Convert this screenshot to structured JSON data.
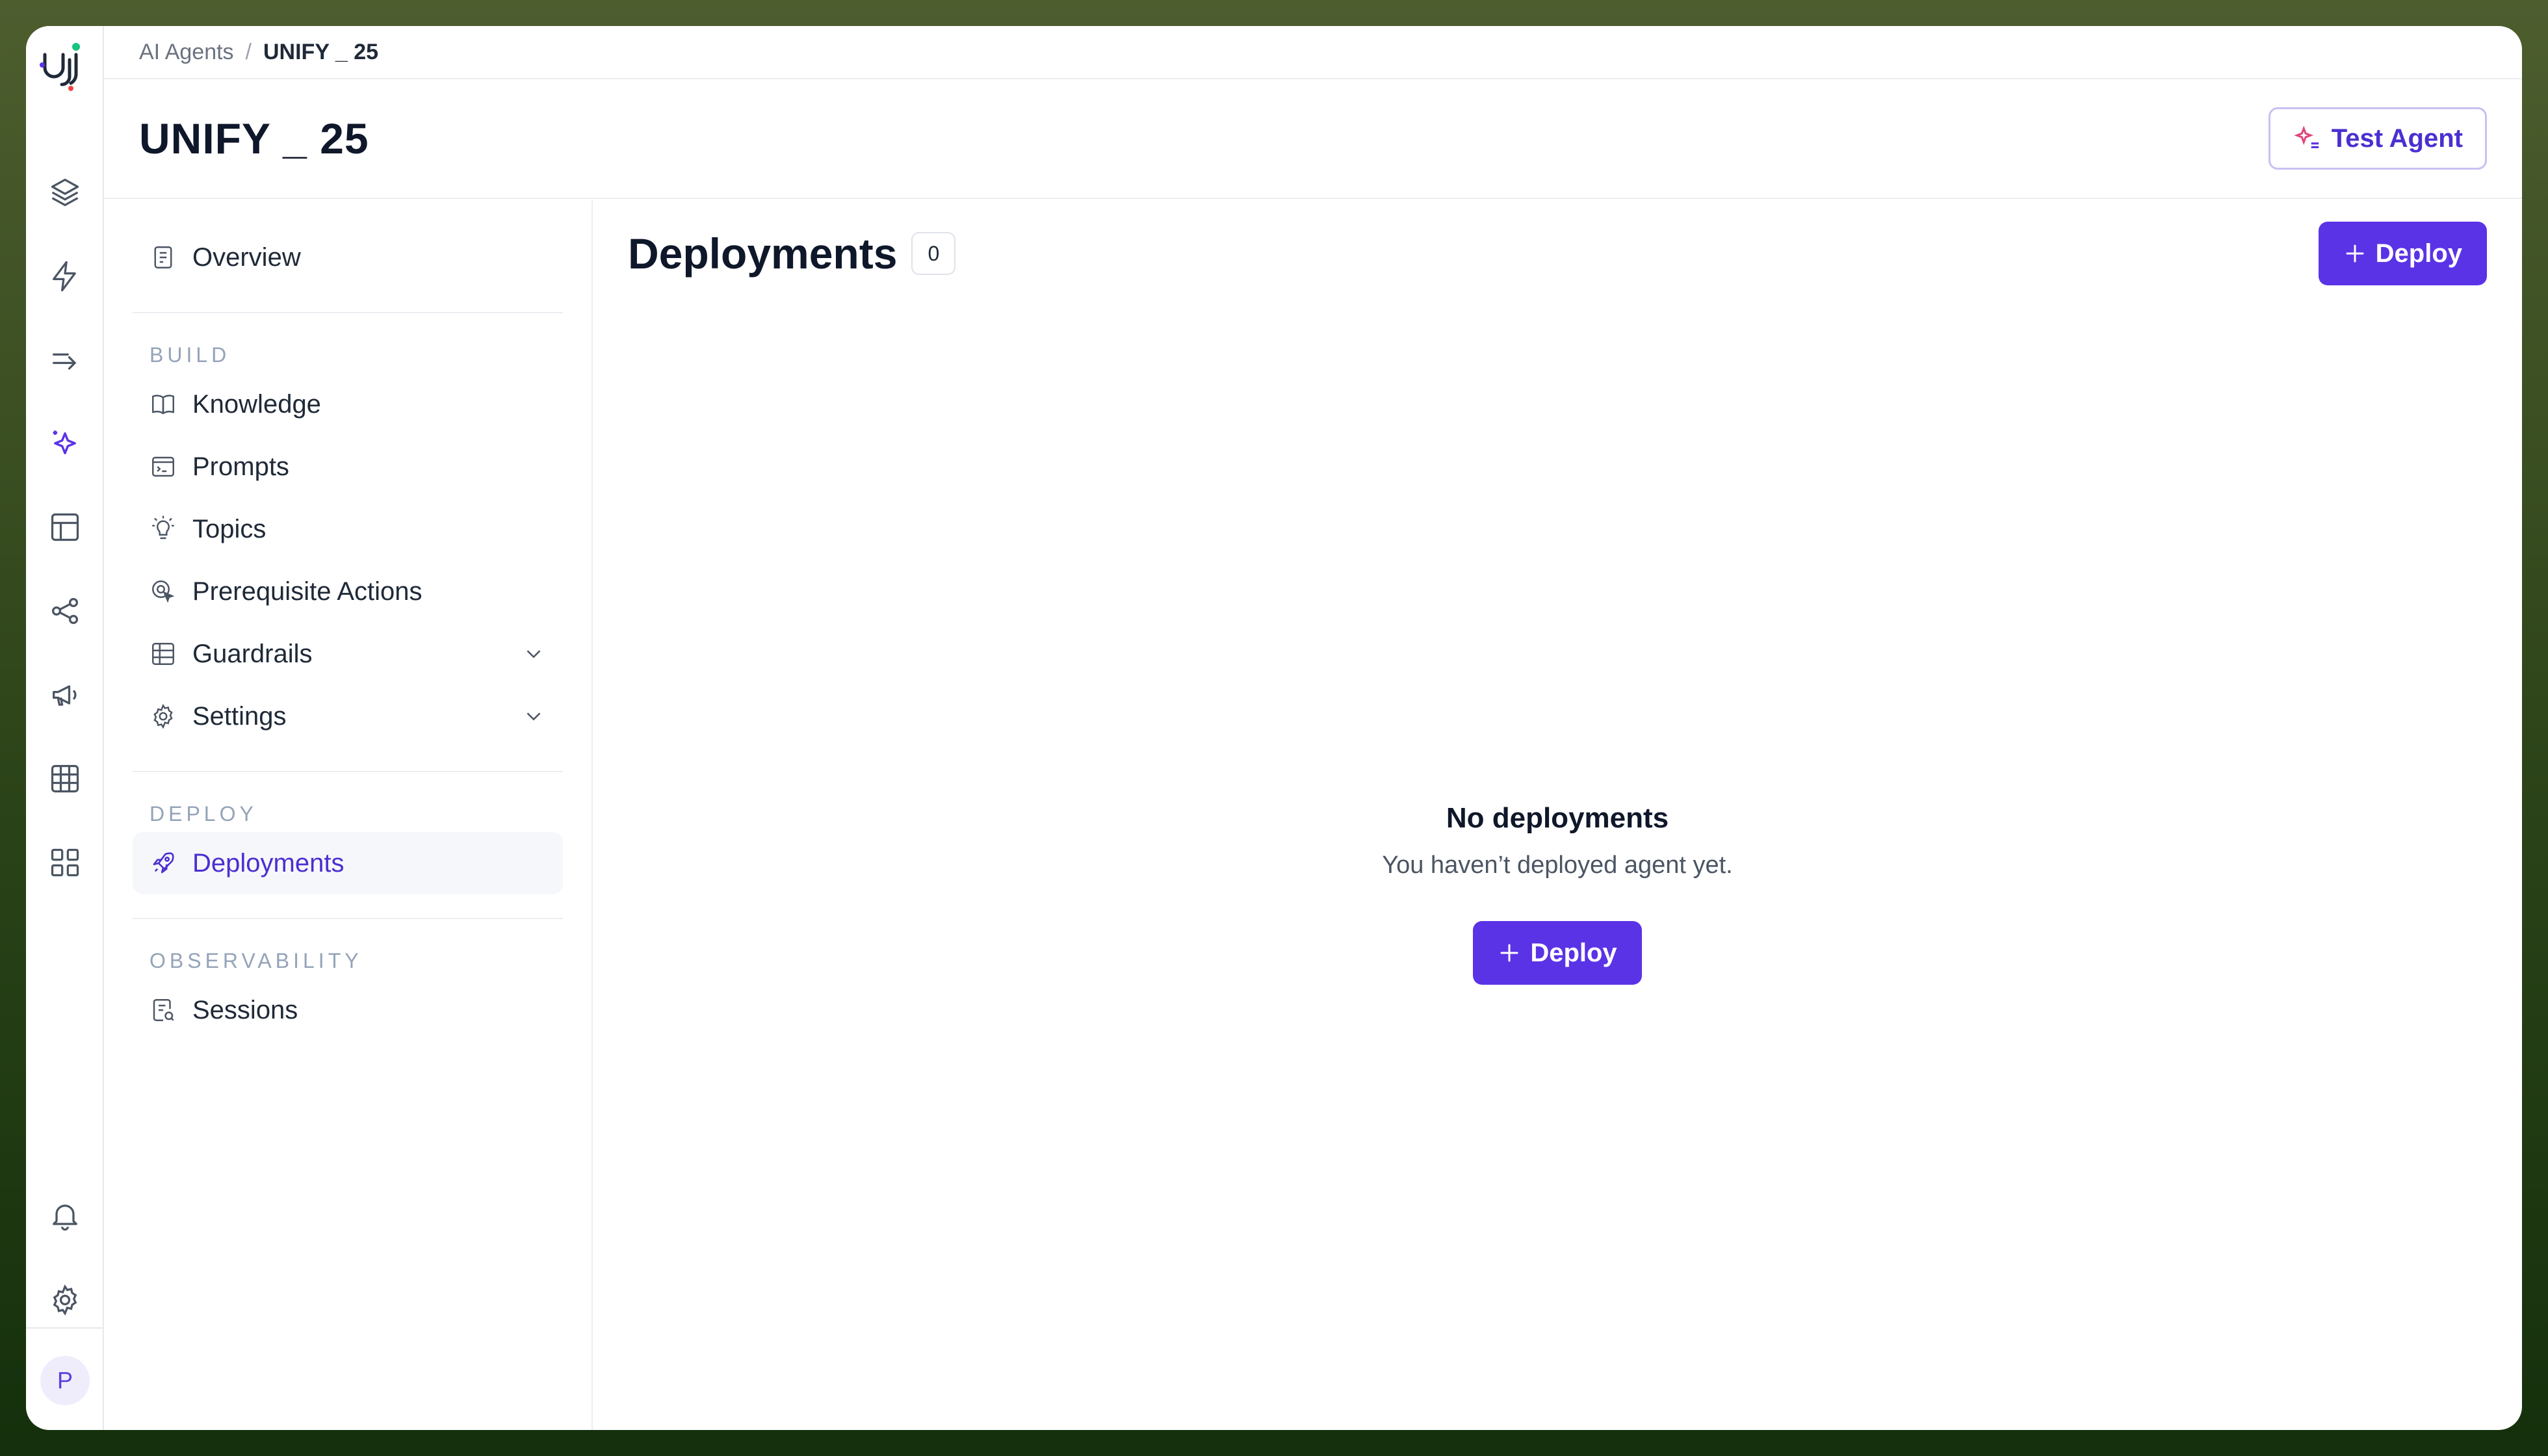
{
  "breadcrumb": {
    "parent": "AI Agents",
    "separator": "/",
    "current": "UNIFY _ 25"
  },
  "header": {
    "title": "UNIFY _ 25",
    "test_agent_label": "Test Agent"
  },
  "rail": {
    "icons": [
      "layers-icon",
      "lightning-icon",
      "arrow-route-icon",
      "sparkles-icon",
      "layout-icon",
      "share-icon",
      "megaphone-icon",
      "table-icon",
      "apps-grid-icon",
      "bell-icon",
      "gear-icon"
    ],
    "active": "sparkles-icon",
    "avatar_initial": "P"
  },
  "sidenav": {
    "overview": "Overview",
    "build_label": "BUILD",
    "build_items": [
      "Knowledge",
      "Prompts",
      "Topics",
      "Prerequisite Actions",
      "Guardrails",
      "Settings"
    ],
    "deploy_label": "DEPLOY",
    "deploy_items": [
      "Deployments"
    ],
    "observability_label": "OBSERVABILITY",
    "observability_items": [
      "Sessions"
    ],
    "active": "Deployments"
  },
  "content": {
    "title": "Deployments",
    "count": "0",
    "deploy_label": "Deploy",
    "empty_title": "No deployments",
    "empty_desc": "You haven’t deployed agent yet.",
    "empty_button": "Deploy"
  },
  "colors": {
    "accent": "#5b33e6",
    "accent_text": "#4b2fd1",
    "border": "#eceef2"
  }
}
